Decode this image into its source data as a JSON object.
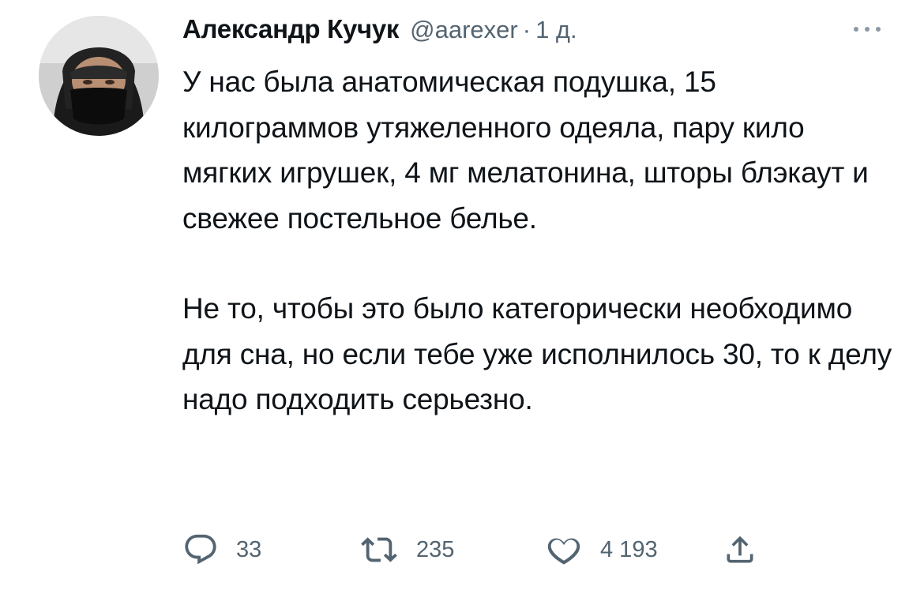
{
  "author": {
    "name": "Александр Кучук",
    "handle": "@aarexer",
    "separator": "·",
    "time": "1 д."
  },
  "tweet": {
    "paragraphs": [
      "У нас была анатомическая подушка, 15 килограммов утяжеленного одеяла, пару кило мягких игрушек, 4 мг мелатонина, шторы блэкаут и свежее постельное белье.",
      "Не то, чтобы это было категорически необходимо для сна, но если тебе уже исполнилось 30, то к делу надо подходить серьезно."
    ]
  },
  "actions": {
    "replies": "33",
    "retweets": "235",
    "likes": "4 193"
  },
  "icons": {
    "reply": "reply-icon",
    "retweet": "retweet-icon",
    "like": "heart-icon",
    "share": "share-icon",
    "more": "more-icon"
  },
  "colors": {
    "text": "#0f1419",
    "secondary": "#536471",
    "background": "#ffffff"
  }
}
